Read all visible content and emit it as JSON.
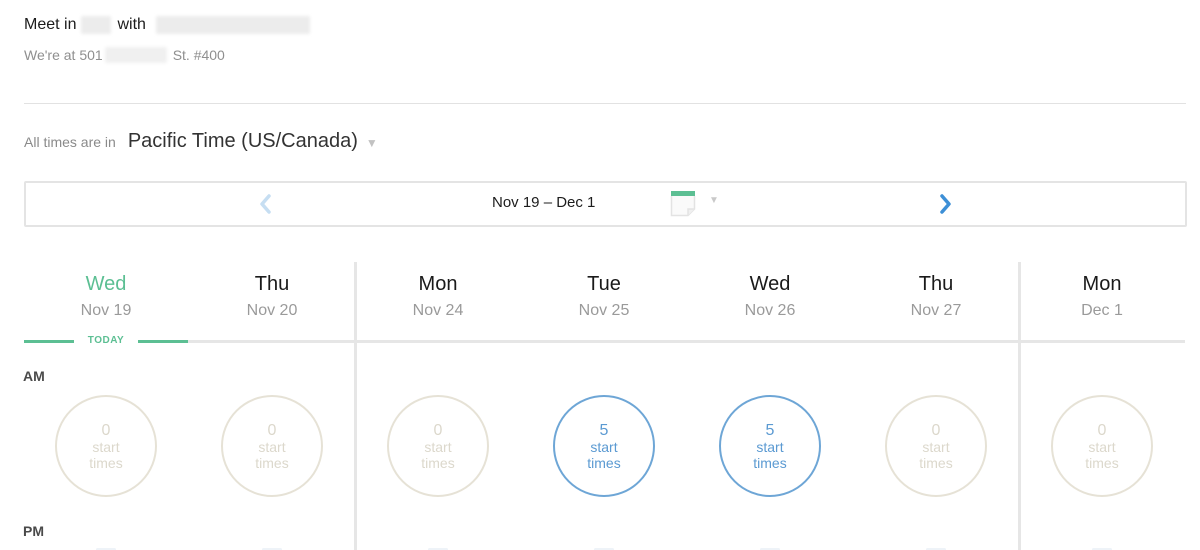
{
  "header": {
    "title_prefix": "Meet in",
    "title_with": "with",
    "address_prefix": "We're at 501",
    "address_suffix": "St. #400"
  },
  "timezone": {
    "label": "All times are in",
    "value": "Pacific Time (US/Canada)",
    "caret": "▼"
  },
  "nav": {
    "range": "Nov 19 – Dec 1",
    "prev_icon": "chevron-left-icon",
    "next_icon": "chevron-right-icon",
    "calendar_icon": "calendar-icon",
    "calendar_caret": "▼",
    "prev_color": "#c6def2",
    "next_color": "#3d8fd6",
    "calendar_accent": "#5cbf93"
  },
  "calendar": {
    "today_label": "TODAY",
    "am_label": "AM",
    "pm_label": "PM",
    "days": [
      {
        "dow": "Wed",
        "date": "Nov 19",
        "today": true,
        "count": "0",
        "unit_line1": "start",
        "unit_line2": "times",
        "available": false
      },
      {
        "dow": "Thu",
        "date": "Nov 20",
        "today": false,
        "count": "0",
        "unit_line1": "start",
        "unit_line2": "times",
        "available": false
      },
      {
        "dow": "Mon",
        "date": "Nov 24",
        "today": false,
        "count": "0",
        "unit_line1": "start",
        "unit_line2": "times",
        "available": false
      },
      {
        "dow": "Tue",
        "date": "Nov 25",
        "today": false,
        "count": "5",
        "unit_line1": "start",
        "unit_line2": "times",
        "available": true
      },
      {
        "dow": "Wed",
        "date": "Nov 26",
        "today": false,
        "count": "5",
        "unit_line1": "start",
        "unit_line2": "times",
        "available": true
      },
      {
        "dow": "Thu",
        "date": "Nov 27",
        "today": false,
        "count": "0",
        "unit_line1": "start",
        "unit_line2": "times",
        "available": false
      },
      {
        "dow": "Mon",
        "date": "Dec 1",
        "today": false,
        "count": "0",
        "unit_line1": "start",
        "unit_line2": "times",
        "available": false
      }
    ]
  },
  "colors": {
    "today_green": "#5cbf93",
    "available_blue": "#5b9ad2",
    "unavailable_beige": "#dcd8cc"
  }
}
